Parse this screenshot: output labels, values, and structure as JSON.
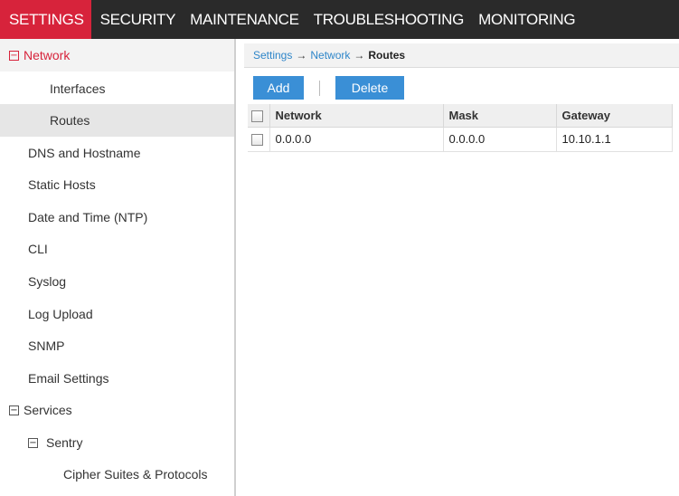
{
  "topnav": {
    "tabs": [
      {
        "label": "SETTINGS",
        "active": true
      },
      {
        "label": "SECURITY",
        "active": false
      },
      {
        "label": "MAINTENANCE",
        "active": false
      },
      {
        "label": "TROUBLESHOOTING",
        "active": false
      },
      {
        "label": "MONITORING",
        "active": false
      }
    ]
  },
  "sidebar": {
    "network": {
      "toggle": "⊟",
      "label": "Network"
    },
    "interfaces": "Interfaces",
    "routes": "Routes",
    "items": [
      "DNS and Hostname",
      "Static Hosts",
      "Date and Time (NTP)",
      "CLI",
      "Syslog",
      "Log Upload",
      "SNMP",
      "Email Settings"
    ],
    "services": {
      "toggle": "⊟",
      "label": "Services"
    },
    "sentry": {
      "toggle": "⊟",
      "label": "Sentry"
    },
    "cipher": "Cipher Suites & Protocols"
  },
  "breadcrumb": {
    "settings": "Settings",
    "arrow": "→",
    "network": "Network",
    "current": "Routes"
  },
  "toolbar": {
    "add_label": "Add",
    "delete_label": "Delete"
  },
  "table": {
    "headers": {
      "network": "Network",
      "mask": "Mask",
      "gateway": "Gateway"
    },
    "rows": [
      {
        "network": "0.0.0.0",
        "mask": "0.0.0.0",
        "gateway": "10.10.1.1"
      }
    ]
  },
  "colors": {
    "accent_red": "#d7233b",
    "button_blue": "#3a8fd6",
    "link_blue": "#2f86c9",
    "topnav_bg": "#2a2a2a"
  }
}
